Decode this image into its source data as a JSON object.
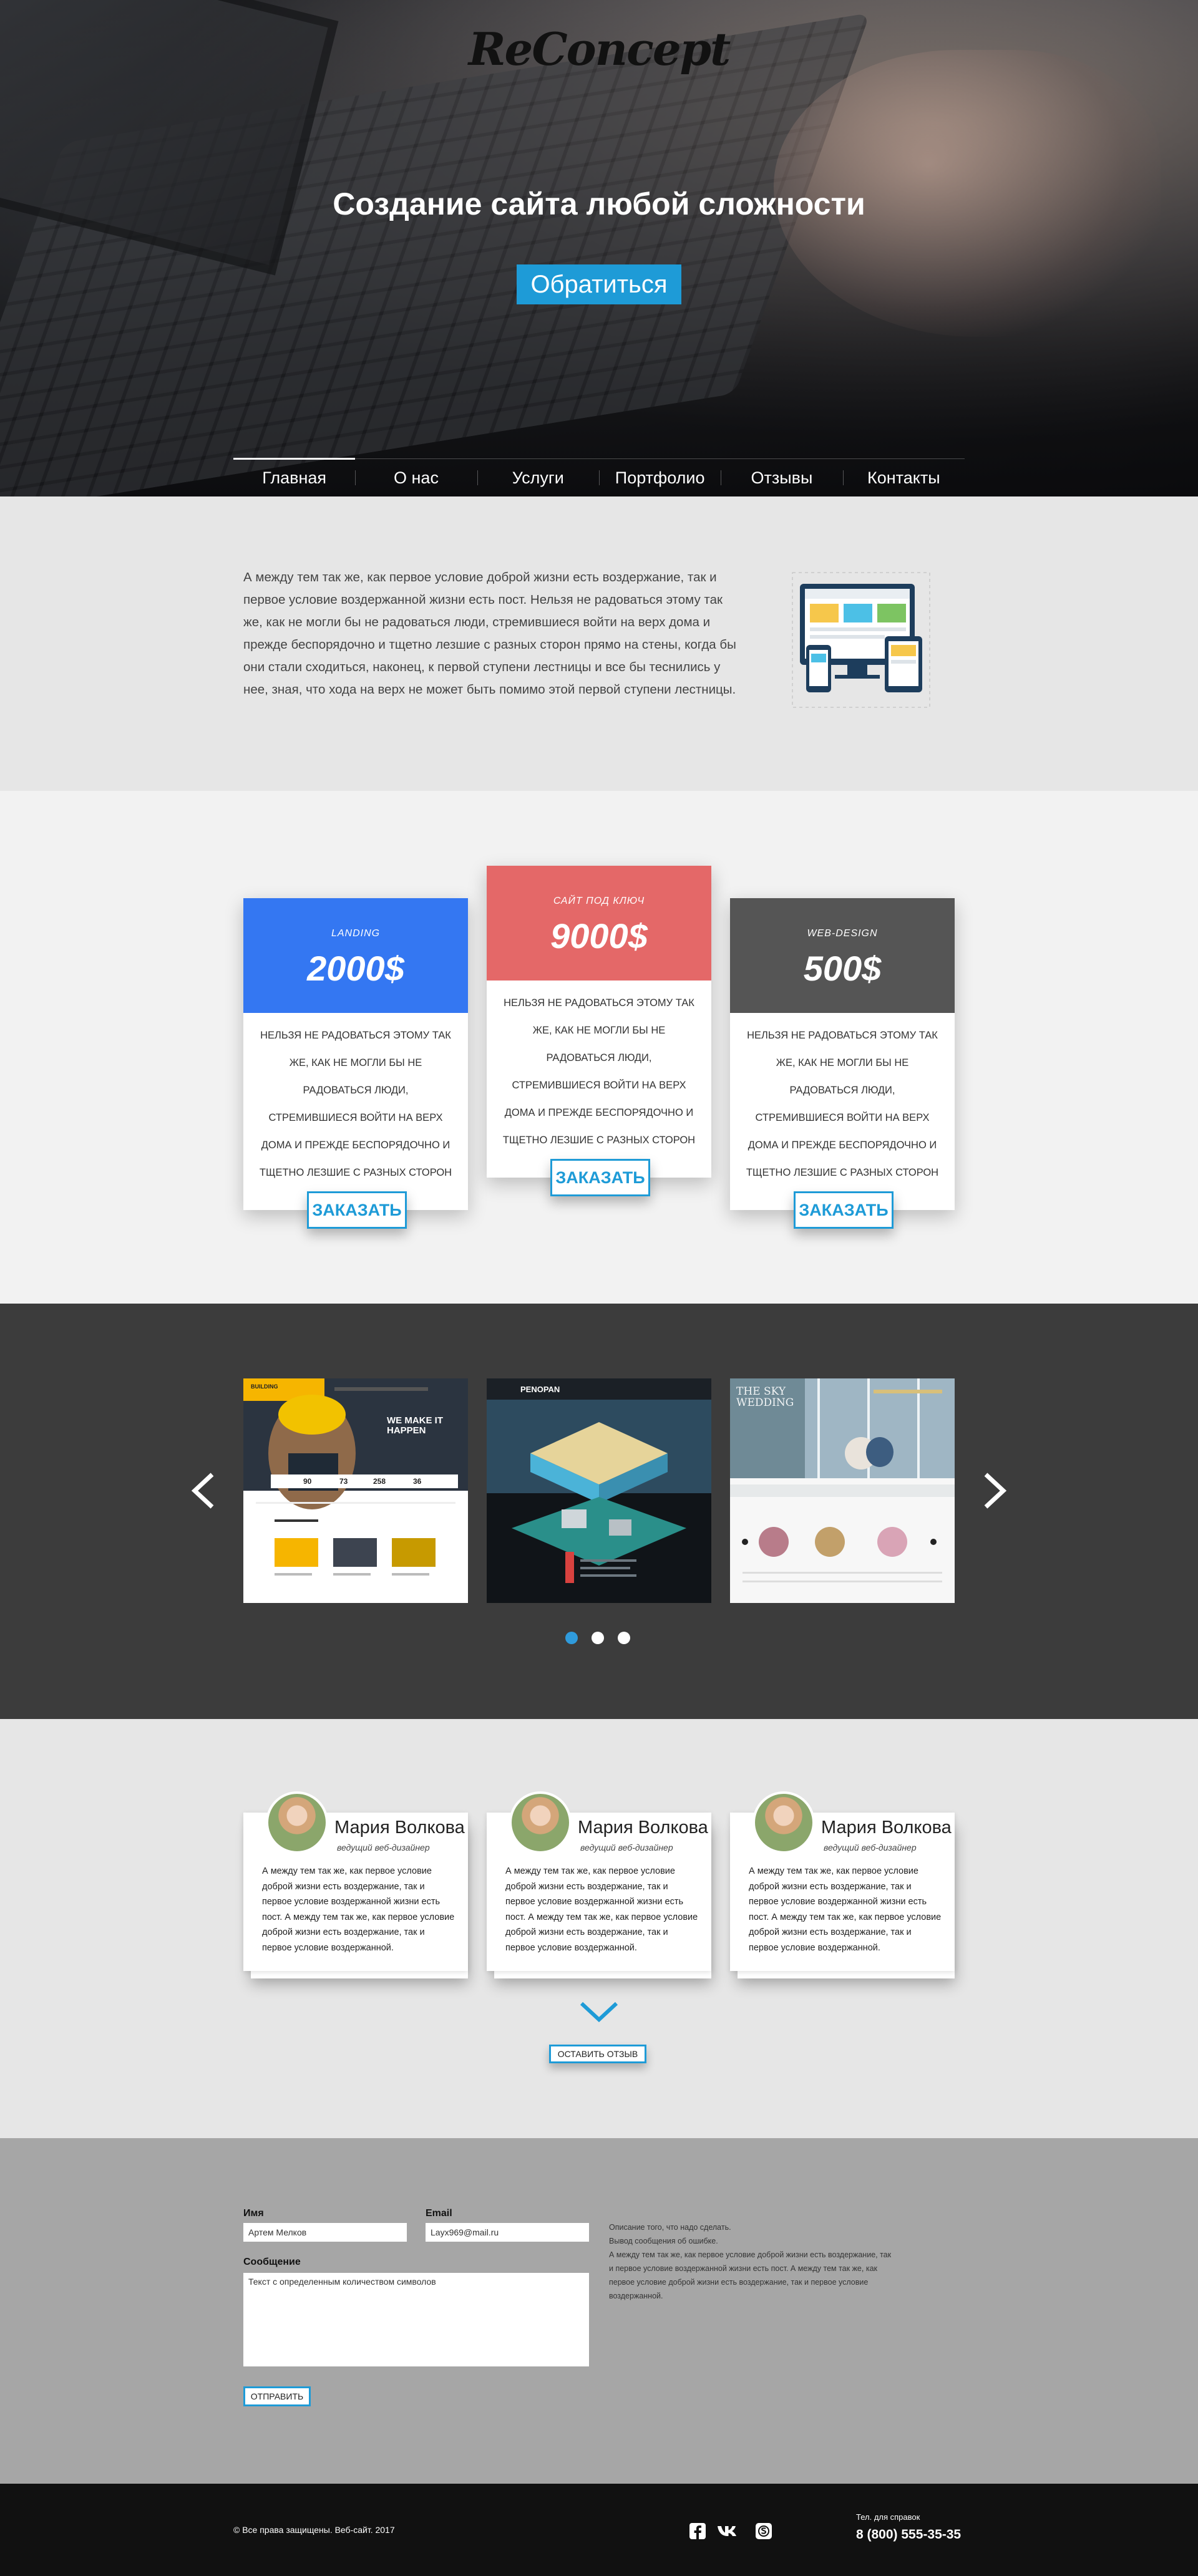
{
  "header": {
    "logo": "ReConcept",
    "title": "Создание сайта любой сложности",
    "cta_label": "Обратиться"
  },
  "nav": {
    "items": [
      {
        "label": "Главная",
        "active": true
      },
      {
        "label": "О нас"
      },
      {
        "label": "Услуги"
      },
      {
        "label": "Портфолио"
      },
      {
        "label": "Отзывы"
      },
      {
        "label": "Контакты"
      }
    ]
  },
  "about": {
    "paragraph": "А между тем так же, как первое условие доброй жизни есть воздержание, так и первое условие воздержанной жизни есть пост. Нельзя не радоваться этому так же, как не могли бы не радоваться люди, стремившиеся войти на верх дома и прежде беспорядочно и тщетно лезшие с разных сторон прямо на стены, когда бы они стали сходиться, наконец, к первой ступени лестницы и все бы теснились у нее, зная, что хода на верх не может быть помимо этой первой ступени лестницы."
  },
  "pricing": {
    "order_label": "ЗАКАЗАТЬ",
    "cards": [
      {
        "label": "LANDING",
        "price": "2000$",
        "color": "#3477f2",
        "desc": "НЕЛЬЗЯ НЕ РАДОВАТЬСЯ ЭТОМУ ТАК ЖЕ, КАК НЕ МОГЛИ БЫ НЕ РАДОВАТЬСЯ ЛЮДИ, СТРЕМИВШИЕСЯ ВОЙТИ НА ВЕРХ ДОМА И ПРЕЖДЕ БЕСПОРЯДОЧНО И ТЩЕТНО ЛЕЗШИЕ С РАЗНЫХ СТОРОН"
      },
      {
        "label": "САЙТ ПОД КЛЮЧ",
        "price": "9000$",
        "color": "#e46868",
        "desc": "НЕЛЬЗЯ НЕ РАДОВАТЬСЯ ЭТОМУ ТАК ЖЕ, КАК НЕ МОГЛИ БЫ НЕ РАДОВАТЬСЯ ЛЮДИ, СТРЕМИВШИЕСЯ ВОЙТИ НА ВЕРХ ДОМА И ПРЕЖДЕ БЕСПОРЯДОЧНО И ТЩЕТНО ЛЕЗШИЕ С РАЗНЫХ СТОРОН"
      },
      {
        "label": "WEB-DESIGN",
        "price": "500$",
        "color": "#555555",
        "desc": "НЕЛЬЗЯ НЕ РАДОВАТЬСЯ ЭТОМУ ТАК ЖЕ, КАК НЕ МОГЛИ БЫ НЕ РАДОВАТЬСЯ ЛЮДИ, СТРЕМИВШИЕСЯ ВОЙТИ НА ВЕРХ ДОМА И ПРЕЖДЕ БЕСПОРЯДОЧНО И ТЩЕТНО ЛЕЗШИЕ С РАЗНЫХ СТОРОН"
      }
    ]
  },
  "portfolio": {
    "prev_icon": "chevron-left-icon",
    "next_icon": "chevron-right-icon",
    "slides": [
      {
        "brand": "BUILDING",
        "headline": "WE MAKE IT HAPPEN",
        "stats": [
          "90",
          "73",
          "258",
          "36"
        ]
      },
      {
        "brand": "PENOPAN"
      },
      {
        "brand": "THE SKY WEDDING"
      }
    ],
    "active_dot": 0,
    "dot_count": 3
  },
  "reviews": {
    "items": [
      {
        "name": "Мария Волкова",
        "role": "ведущий веб-дизайнер",
        "text": "А между тем так же, как первое условие доброй жизни есть воздержание, так и первое условие воздержанной жизни есть пост. А между тем так же, как первое условие доброй жизни есть воздержание, так и первое условие воздержанной."
      },
      {
        "name": "Мария Волкова",
        "role": "ведущий веб-дизайнер",
        "text": "А между тем так же, как первое условие доброй жизни есть воздержание, так и первое условие воздержанной жизни есть пост. А между тем так же, как первое условие доброй жизни есть воздержание, так и первое условие воздержанной."
      },
      {
        "name": "Мария Волкова",
        "role": "ведущий веб-дизайнер",
        "text": "А между тем так же, как первое условие доброй жизни есть воздержание, так и первое условие воздержанной жизни есть пост. А между тем так же, как первое условие доброй жизни есть воздержание, так и первое условие воздержанной."
      }
    ],
    "expand_icon": "chevron-down-icon",
    "leave_label": "ОСТАВИТЬ ОТЗЫВ"
  },
  "contact": {
    "name_label": "Имя",
    "name_value": "Артем Мелков",
    "email_label": "Email",
    "email_value": "Layx969@mail.ru",
    "message_label": "Сообщение",
    "message_value": "Текст с определенным количеством символов",
    "send_label": "ОТПРАВИТЬ",
    "info_lines": [
      "Описание того, что надо сделать.",
      "Вывод сообщения об ошибке.",
      "А между тем так же, как первое условие доброй жизни есть воздержание, так",
      "и первое условие воздержанной жизни есть пост. А между тем так же, как",
      "первое условие доброй жизни есть воздержание, так и первое условие",
      "воздержанной."
    ]
  },
  "footer": {
    "copyright": "© Все права защищены. Веб-сайт. 2017",
    "social": [
      "facebook-icon",
      "vk-icon",
      "skype-icon"
    ],
    "phone_label": "Тел. для справок",
    "phone": "8 (800) 555-35-35"
  },
  "colors": {
    "accent": "#1e9bd7",
    "footer_bg": "#111111",
    "contact_bg": "#a6a6a6",
    "portfolio_bg": "#3c3c3c"
  }
}
